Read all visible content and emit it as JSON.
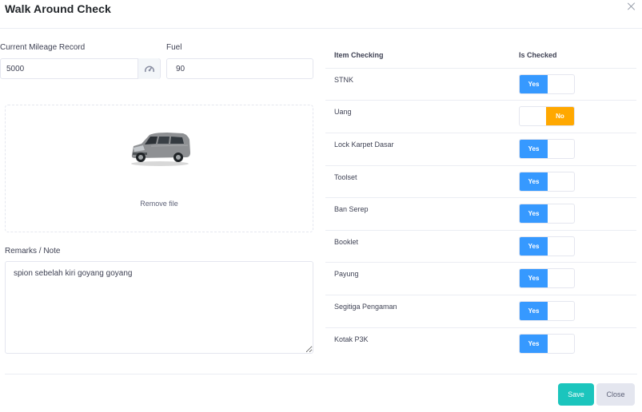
{
  "modal": {
    "title": "Walk Around Check"
  },
  "form": {
    "mileage": {
      "label": "Current Mileage Record",
      "value": "5000"
    },
    "fuel": {
      "label": "Fuel",
      "value": "90"
    },
    "upload": {
      "remove_label": "Remove file"
    },
    "remarks": {
      "label": "Remarks / Note",
      "value": "spion sebelah kiri goyang goyang"
    }
  },
  "checklist": {
    "headers": {
      "item": "Item Checking",
      "checked": "Is Checked"
    },
    "items": [
      {
        "label": "STNK",
        "state": "Yes"
      },
      {
        "label": "Uang",
        "state": "No"
      },
      {
        "label": "Lock Karpet Dasar",
        "state": "Yes"
      },
      {
        "label": "Toolset",
        "state": "Yes"
      },
      {
        "label": "Ban Serep",
        "state": "Yes"
      },
      {
        "label": "Booklet",
        "state": "Yes"
      },
      {
        "label": "Payung",
        "state": "Yes"
      },
      {
        "label": "Segitiga Pengaman",
        "state": "Yes"
      },
      {
        "label": "Kotak P3K",
        "state": "Yes"
      }
    ]
  },
  "footer": {
    "save_label": "Save",
    "close_label": "Close"
  },
  "colors": {
    "yes": "#3699ff",
    "no": "#ffa800",
    "save": "#1bc5bd",
    "close": "#e4e6ef"
  }
}
